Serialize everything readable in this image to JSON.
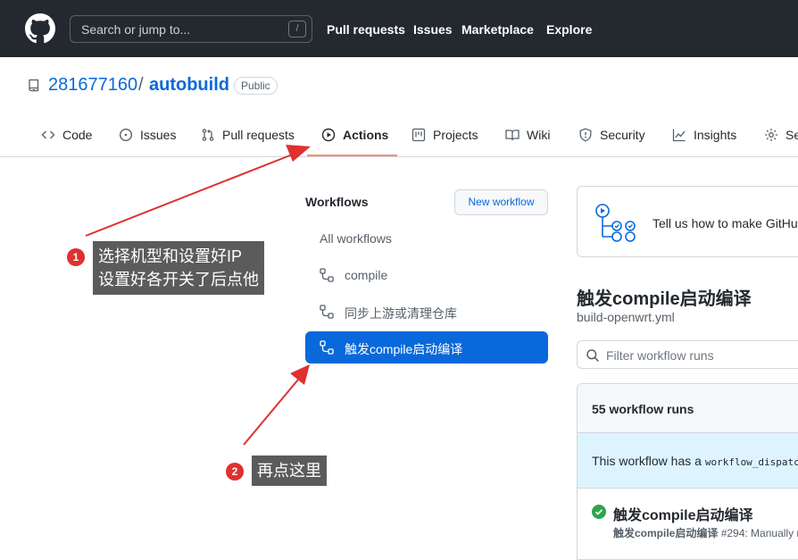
{
  "header": {
    "logo_icon": "github-octocat-icon",
    "search_placeholder": "Search or jump to...",
    "search_shortcut": "/",
    "nav": [
      "Pull requests",
      "Issues",
      "Marketplace",
      "Explore"
    ]
  },
  "repo": {
    "owner": "281677160",
    "separator": "/",
    "name": "autobuild",
    "visibility": "Public"
  },
  "tabs": [
    {
      "label": "Code",
      "icon": "code-icon"
    },
    {
      "label": "Issues",
      "icon": "issue-icon"
    },
    {
      "label": "Pull requests",
      "icon": "pull-request-icon"
    },
    {
      "label": "Actions",
      "icon": "play-icon",
      "active": true
    },
    {
      "label": "Projects",
      "icon": "project-icon"
    },
    {
      "label": "Wiki",
      "icon": "book-icon"
    },
    {
      "label": "Security",
      "icon": "shield-icon"
    },
    {
      "label": "Insights",
      "icon": "graph-icon"
    },
    {
      "label": "Se",
      "icon": "gear-icon"
    }
  ],
  "sidebar": {
    "title": "Workflows",
    "new_workflow": "New workflow",
    "all_workflows": "All workflows",
    "items": [
      {
        "label": "compile",
        "icon": "workflow-icon"
      },
      {
        "label": "同步上游或清理仓库",
        "icon": "workflow-icon"
      },
      {
        "label": "触发compile启动编译",
        "icon": "workflow-icon",
        "selected": true
      }
    ]
  },
  "main": {
    "banner_text": "Tell us how to make GitHul",
    "workflow_title": "触发compile启动编译",
    "workflow_file": "build-openwrt.yml",
    "filter_placeholder": "Filter workflow runs",
    "runs_count": "55 workflow runs",
    "dispatch_text": "This workflow has a ",
    "dispatch_code": "workflow_dispatc",
    "run": {
      "title": "触发compile启动编译",
      "meta_name": "触发compile启动编译",
      "meta_rest": " #294: Manually r",
      "status": "success"
    }
  },
  "annotations": {
    "step1_number": "1",
    "step1_line1": "选择机型和设置好IP",
    "step1_line2": "设置好各开关了后点他",
    "step2_number": "2",
    "step2_text": "再点这里",
    "color": "#e03030"
  },
  "colors": {
    "header_bg": "#24292f",
    "link": "#0969da",
    "selected_bg": "#0969da",
    "tab_underline": "#fd8c73",
    "success": "#2da44e",
    "info_bg": "#ddf4ff"
  }
}
